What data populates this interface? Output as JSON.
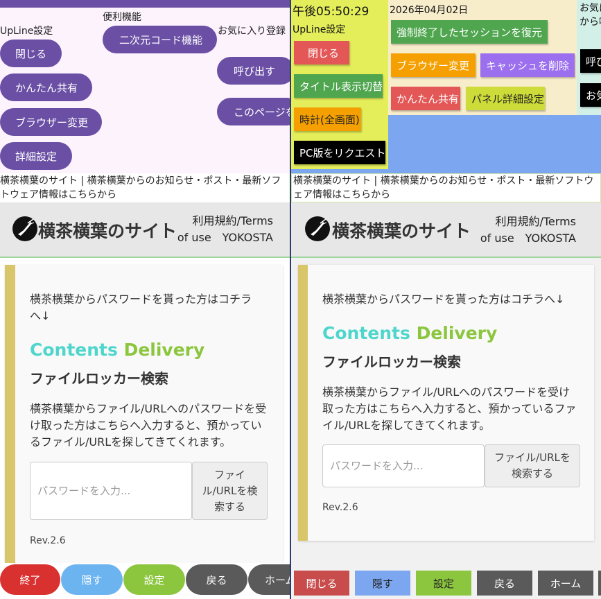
{
  "colors": {
    "purple": "#6a4fa5",
    "red": "#e05a5a",
    "green": "#4fa64f",
    "orange": "#f59f00",
    "violet": "#9b6fee",
    "yellow_green": "#cddc39",
    "black": "#000000",
    "cyan_text": "#4fd6cc",
    "lime_text": "#8cc63e",
    "card_bar": "#d9c66a"
  },
  "left": {
    "menu": {
      "col_upline_title": "UpLine設定",
      "col_convenient_title": "便利機能",
      "col_favorites_title": "お気に入り登録",
      "buttons": {
        "close": "閉じる",
        "easy_share": "かんたん共有",
        "browser_change": "ブラウザー変更",
        "details": "詳細設定",
        "qr_code": "二次元コード機能",
        "call": "呼び出す",
        "this_page": "このページを"
      }
    },
    "description": "横茶横葉のサイト | 横茶横葉からのお知らせ・ポスト・最新ソフトウェア情報はこちらから",
    "bottom_bar": {
      "exit": "終了",
      "hide": "隠す",
      "settings": "設定",
      "back": "戻る",
      "home": "ホーム"
    }
  },
  "site": {
    "title": "横茶横葉のサイト",
    "terms_line1": "利用規約/Terms",
    "terms_line2": "of use　YOKOSTA",
    "intro": "横茶横葉からパスワードを貰った方はコチラへ↓",
    "cd_part1": "Contents",
    "cd_part2": "Delivery",
    "locker_title": "ファイルロッカー検索",
    "body": "横茶横葉からファイル/URLへのパスワードを受け取った方はこちらへ入力すると、預かっているファイル/URLを探してきてくれます。",
    "password_placeholder": "パスワードを入力...",
    "search_button": "ファイル/URLを検索する",
    "revision": "Rev.2.6"
  },
  "right": {
    "clock": "午後05:50:29",
    "date": "2026年04月02日",
    "upline_title": "UpLine設定",
    "fav_title_line1": "お気に",
    "fav_title_line2": "から呼",
    "buttons": {
      "close": "閉じる",
      "title_toggle": "タイトル表示切替",
      "clock_fullscreen": "時計(全画面)",
      "pc_request": "PC版をリクエスト",
      "restore_session": "強制終了したセッションを復元",
      "browser_change": "ブラウザー変更",
      "clear_cache": "キャッシュを削除",
      "easy_share": "かんたん共有",
      "panel_details": "パネル詳細設定",
      "call": "呼び",
      "fav": "お気"
    },
    "description": "横茶横葉のサイト | 横茶横葉からのお知らせ・ポスト・最新ソフトウェア情報はこちらから",
    "bottom_bar": {
      "close": "閉じる",
      "hide": "隠す",
      "settings": "設定",
      "back": "戻る",
      "home": "ホーム"
    }
  }
}
